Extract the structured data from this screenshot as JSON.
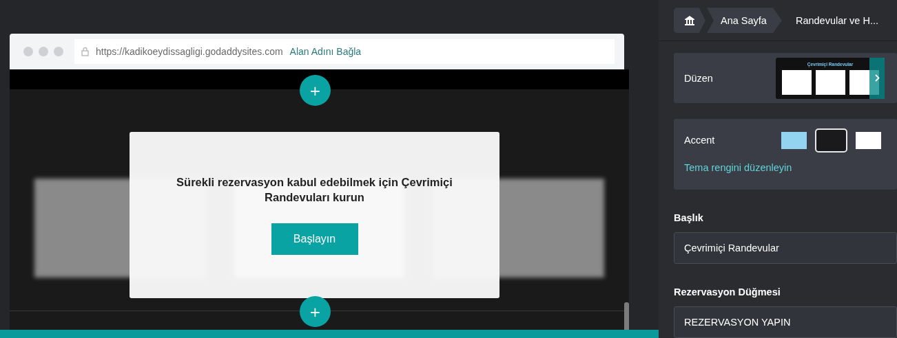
{
  "browser": {
    "url": "https://kadikoeydissagligi.godaddysites.com",
    "domain_link": "Alan Adını Bağla"
  },
  "dialog": {
    "message": "Sürekli rezervasyon kabul edebilmek için Çevrimiçi Randevuları kurun",
    "button": "Başlayın"
  },
  "add_section_buttons": [
    "+",
    "+"
  ],
  "breadcrumb": [
    "Ana Sayfa",
    "Randevular ve H..."
  ],
  "layout": {
    "label": "Düzen",
    "thumbnail_title": "Çevrimiçi Randevular"
  },
  "accent": {
    "label": "Accent",
    "swatches": [
      {
        "color": "#93d5f0",
        "selected": false
      },
      {
        "color": "#1a1a1c",
        "selected": true
      },
      {
        "color": "#ffffff",
        "selected": false
      }
    ],
    "link": "Tema rengini düzenleyin"
  },
  "fields": [
    {
      "label": "Başlık",
      "value": "Çevrimiçi Randevular"
    },
    {
      "label": "Rezervasyon Düğmesi",
      "value": "REZERVASYON YAPIN"
    }
  ]
}
